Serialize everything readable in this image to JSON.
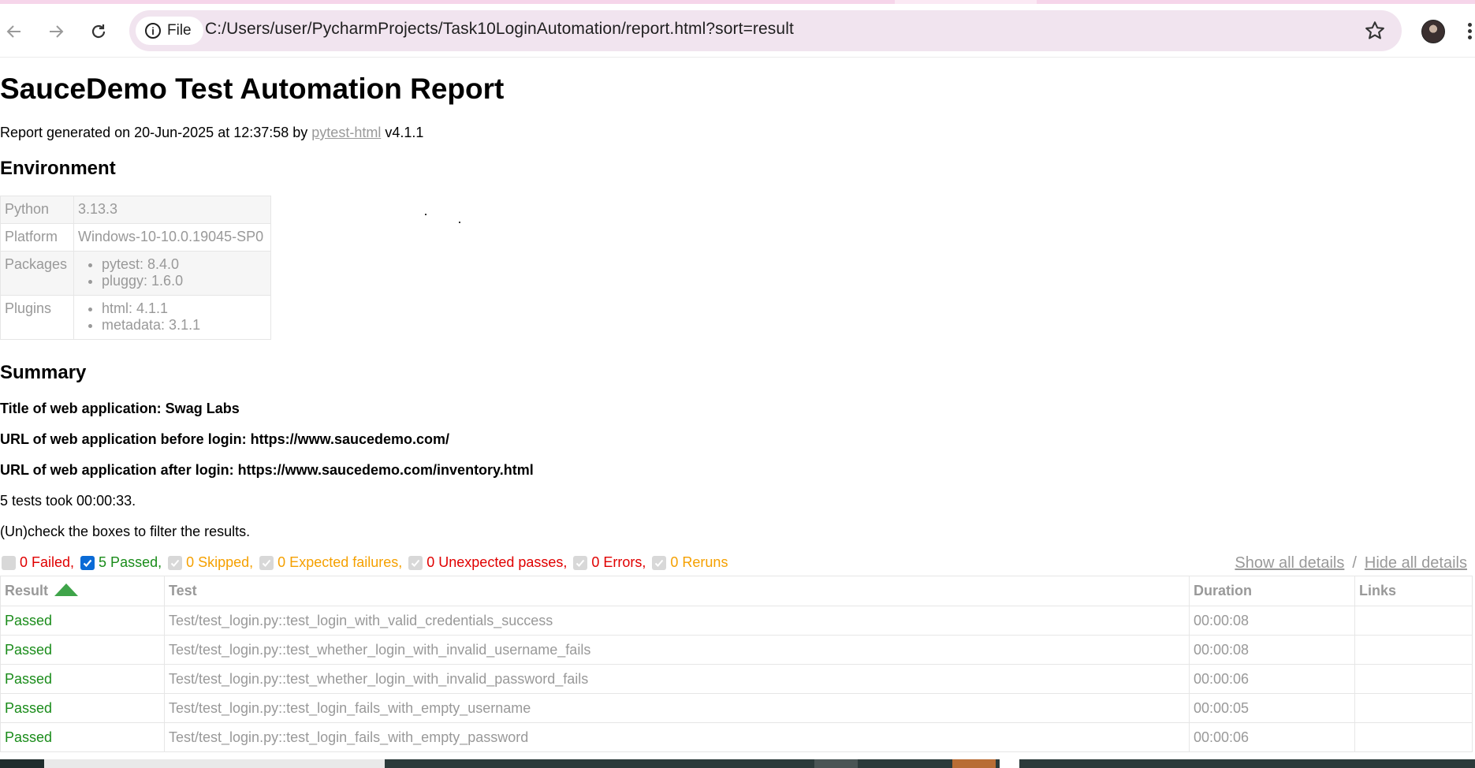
{
  "browser": {
    "chip_label": "File",
    "url": "C:/Users/user/PycharmProjects/Task10LoginAutomation/report.html?sort=result"
  },
  "report": {
    "title": "SauceDemo Test Automation Report",
    "generated_prefix": "Report generated on 20-Jun-2025 at 12:37:58 by ",
    "generated_link": "pytest-html",
    "generated_suffix": " v4.1.1"
  },
  "environment": {
    "heading": "Environment",
    "rows": [
      {
        "key": "Python",
        "value": "3.13.3"
      },
      {
        "key": "Platform",
        "value": "Windows-10-10.0.19045-SP0"
      },
      {
        "key": "Packages",
        "items": [
          "pytest: 8.4.0",
          "pluggy: 1.6.0"
        ]
      },
      {
        "key": "Plugins",
        "items": [
          "html: 4.1.1",
          "metadata: 3.1.1"
        ]
      }
    ]
  },
  "summary": {
    "heading": "Summary",
    "title_line": "Title of web application: Swag Labs",
    "url_before": "URL of web application before login: https://www.saucedemo.com/",
    "url_after": "URL of web application after login: https://www.saucedemo.com/inventory.html",
    "duration_line": "5 tests took 00:00:33.",
    "filter_hint": "(Un)check the boxes to filter the results."
  },
  "filters": [
    {
      "label": "0 Failed,",
      "checked": false,
      "cls": "c-failed"
    },
    {
      "label": "5 Passed,",
      "checked": true,
      "cls": "c-passed"
    },
    {
      "label": "0 Skipped,",
      "checked": false,
      "cls": "c-skipped"
    },
    {
      "label": "0 Expected failures,",
      "checked": false,
      "cls": "c-xfailed"
    },
    {
      "label": "0 Unexpected passes,",
      "checked": false,
      "cls": "c-xpassed"
    },
    {
      "label": "0 Errors,",
      "checked": false,
      "cls": "c-error"
    },
    {
      "label": "0 Reruns",
      "checked": false,
      "cls": "c-rerun"
    }
  ],
  "detail_links": {
    "show": "Show all details",
    "separator": "/",
    "hide": "Hide all details"
  },
  "results": {
    "headers": [
      "Result",
      "Test",
      "Duration",
      "Links"
    ],
    "rows": [
      {
        "result": "Passed",
        "test": "Test/test_login.py::test_login_with_valid_credentials_success",
        "duration": "00:00:08",
        "links": ""
      },
      {
        "result": "Passed",
        "test": "Test/test_login.py::test_whether_login_with_invalid_username_fails",
        "duration": "00:00:08",
        "links": ""
      },
      {
        "result": "Passed",
        "test": "Test/test_login.py::test_whether_login_with_invalid_password_fails",
        "duration": "00:00:06",
        "links": ""
      },
      {
        "result": "Passed",
        "test": "Test/test_login.py::test_login_fails_with_empty_username",
        "duration": "00:00:05",
        "links": ""
      },
      {
        "result": "Passed",
        "test": "Test/test_login.py::test_login_fails_with_empty_password",
        "duration": "00:00:06",
        "links": ""
      }
    ]
  }
}
